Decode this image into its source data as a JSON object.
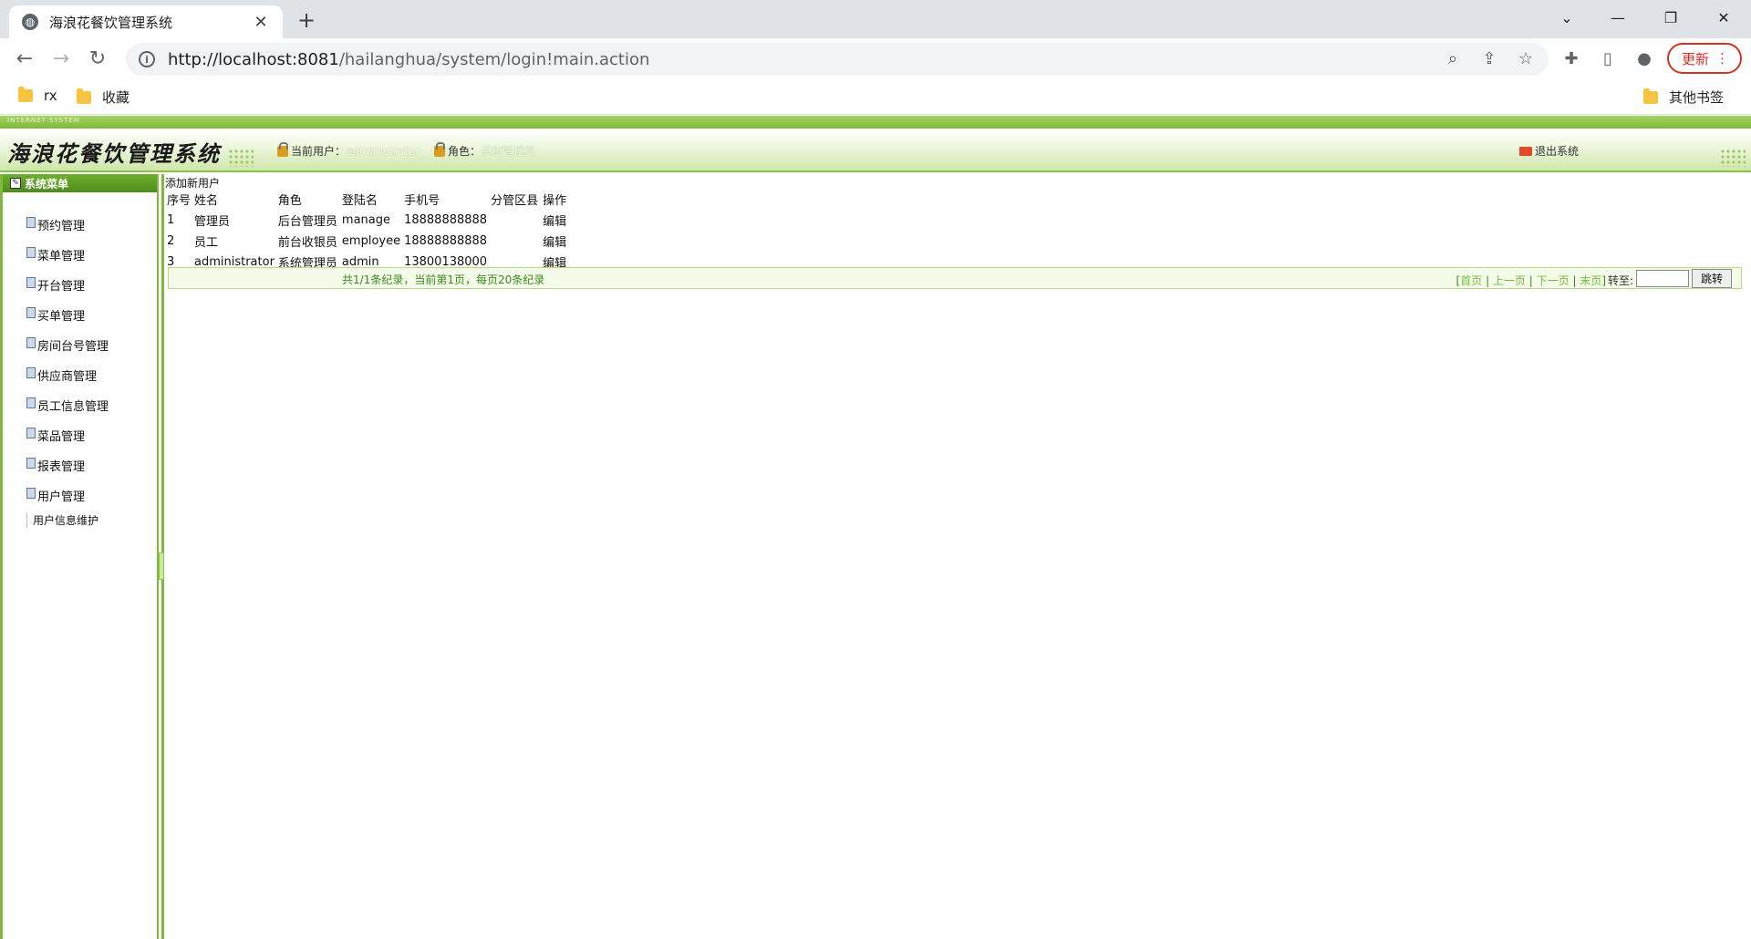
{
  "browser": {
    "tab_title": "海浪花餐饮管理系统",
    "url_host": "http://localhost:8081",
    "url_path": "/hailanghua/system/login!main.action",
    "update_label": "更新",
    "bookmarks": [
      "rx",
      "收藏"
    ],
    "other_bookmarks": "其他书签"
  },
  "header": {
    "band_text": "INTERNET SYSTEM",
    "logo_text": "海浪花餐饮管理系统",
    "current_user_label": "当前用户：",
    "current_user": "administrator",
    "role_label": "角色：",
    "role": "系统管理员",
    "logout_label": "退出系统"
  },
  "sidebar": {
    "title": "系统菜单",
    "items": [
      "预约管理",
      "菜单管理",
      "开台管理",
      "买单管理",
      "房间台号管理",
      "供应商管理",
      "员工信息管理",
      "菜品管理",
      "报表管理",
      "用户管理"
    ],
    "sub_item": "用户信息维护"
  },
  "main": {
    "add_link": "添加新用户",
    "columns": [
      "序号",
      "姓名",
      "角色",
      "登陆名",
      "手机号",
      "分管区县",
      "操作"
    ],
    "rows": [
      [
        "1",
        "管理员",
        "后台管理员",
        "manage",
        "18888888888",
        "",
        "编辑"
      ],
      [
        "2",
        "员工",
        "前台收银员",
        "employee",
        "18888888888",
        "",
        "编辑"
      ],
      [
        "3",
        "administrator",
        "系统管理员",
        "admin",
        "13800138000",
        "",
        "编辑"
      ]
    ],
    "pager": {
      "summary": "共1/1条纪录，当前第1页，每页20条纪录",
      "first": "首页",
      "prev": "上一页",
      "next": "下一页",
      "last": "末页",
      "goto_label": "转至:",
      "jump_button": "跳转"
    }
  },
  "colors": {
    "accent_green": "#7fb83a",
    "pager_text": "#3b8a1f"
  }
}
